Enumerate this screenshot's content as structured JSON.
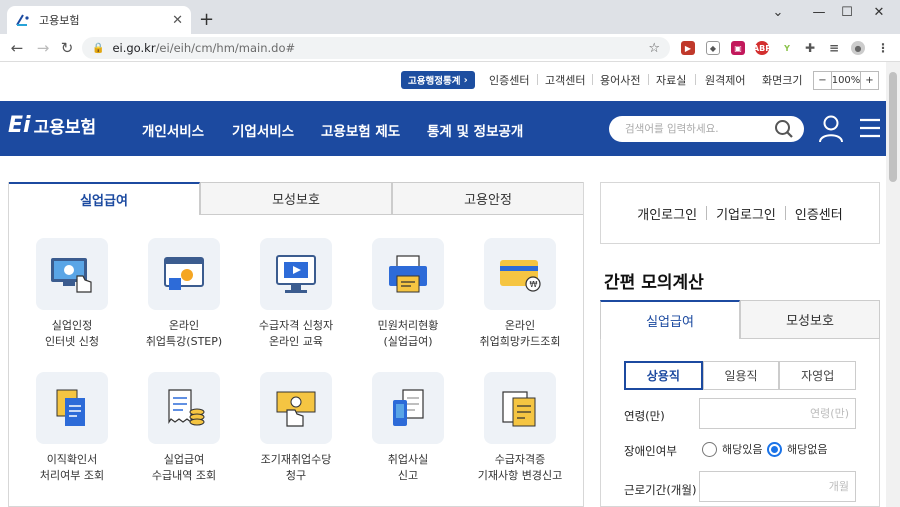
{
  "browser": {
    "tab_title": "고용보험",
    "url_host": "ei.go.kr",
    "url_path": "/ei/eih/cm/hm/main.do#"
  },
  "util": {
    "admin_stats": "고용행정통계",
    "links": [
      "인증센터",
      "고객센터",
      "용어사전",
      "자료실",
      "원격제어"
    ],
    "screen_size_label": "화면크기",
    "zoom_minus": "−",
    "zoom_value": "100%",
    "zoom_plus": "+"
  },
  "header": {
    "logo_mark": "Ei",
    "logo_text": "고용보험",
    "menu": [
      "개인서비스",
      "기업서비스",
      "고용보험 제도",
      "통계 및 정보공개"
    ],
    "search_placeholder": "검색어를 입력하세요."
  },
  "main_tabs": [
    "실업급여",
    "모성보호",
    "고용안정"
  ],
  "services": [
    {
      "line1": "실업인정",
      "line2": "인터넷 신청",
      "icon": "monitor-hand-icon"
    },
    {
      "line1": "온라인",
      "line2": "취업특강(STEP)",
      "icon": "online-lecture-icon"
    },
    {
      "line1": "수급자격 신청자",
      "line2": "온라인 교육",
      "icon": "video-education-icon"
    },
    {
      "line1": "민원처리현황",
      "line2": "(실업급여)",
      "icon": "printer-status-icon"
    },
    {
      "line1": "온라인",
      "line2": "취업희망카드조회",
      "icon": "hope-card-icon"
    },
    {
      "line1": "이직확인서",
      "line2": "처리여부 조회",
      "icon": "document-check-icon"
    },
    {
      "line1": "실업급여",
      "line2": "수급내역 조회",
      "icon": "receipt-coins-icon"
    },
    {
      "line1": "조기재취업수당",
      "line2": "청구",
      "icon": "bonus-claim-icon"
    },
    {
      "line1": "취업사실",
      "line2": "신고",
      "icon": "employment-report-icon"
    },
    {
      "line1": "수급자격증",
      "line2": "기재사항 변경신고",
      "icon": "certificate-edit-icon"
    }
  ],
  "login": {
    "personal": "개인로그인",
    "corporate": "기업로그인",
    "cert": "인증센터"
  },
  "calc": {
    "title": "간편 모의계산",
    "tabs": [
      "실업급여",
      "모성보호"
    ],
    "types": [
      "상용직",
      "일용직",
      "자영업"
    ],
    "age_label": "연령(만)",
    "age_placeholder": "연령(만)",
    "disability_label": "장애인여부",
    "disability_yes": "해당있음",
    "disability_no": "해당없음",
    "period_label": "근로기간(개월)",
    "period_placeholder": "개월"
  },
  "colors": {
    "brand_blue": "#1c4aa0",
    "radio_blue": "#1a73e8"
  }
}
